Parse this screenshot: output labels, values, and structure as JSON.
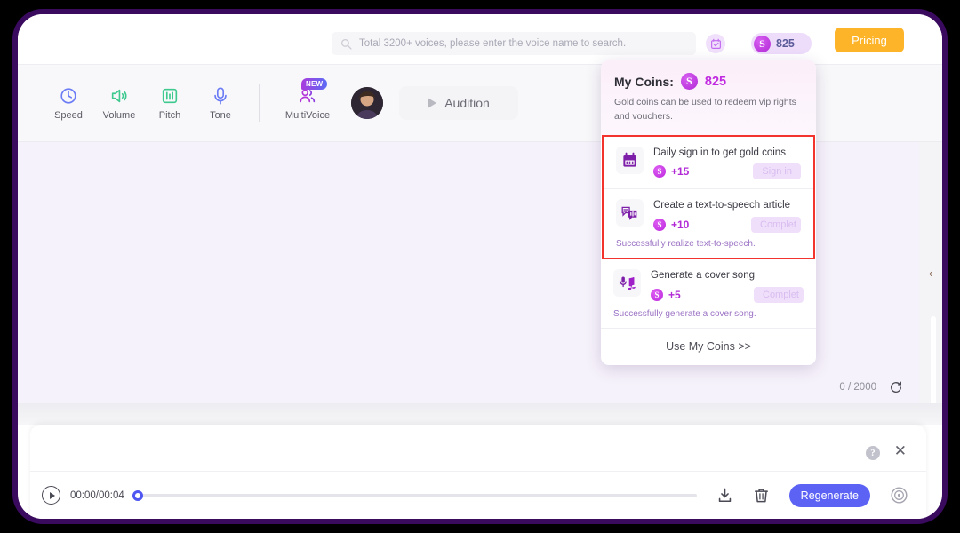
{
  "header": {
    "search": {
      "placeholder": "Total 3200+ voices, please enter the voice name to search.",
      "value": "",
      "icon": "search-icon"
    },
    "calendar_icon": "calendar-check-icon",
    "coins": {
      "amount": "825",
      "symbol": "S"
    },
    "pricing_label": "Pricing"
  },
  "toolbar": {
    "tools": [
      {
        "label": "Speed",
        "icon": "speed-gauge-icon",
        "color": "#6b7cf5"
      },
      {
        "label": "Volume",
        "icon": "volume-icon",
        "color": "#3ec98f"
      },
      {
        "label": "Pitch",
        "icon": "pitch-equalizer-icon",
        "color": "#3ec98f"
      },
      {
        "label": "Tone",
        "icon": "microphone-tone-icon",
        "color": "#6b7cf5"
      }
    ],
    "multivoice": {
      "label": "MultiVoice",
      "icon": "multivoice-people-icon",
      "badge": "NEW"
    },
    "avatar": "voice-avatar",
    "audition_label": "Audition"
  },
  "editor": {
    "text": "",
    "char_count": "0 / 2000",
    "refresh_icon": "refresh-icon"
  },
  "right_rail": {
    "chevron": "‹"
  },
  "player": {
    "help_icon": "help-icon",
    "help_glyph": "?",
    "close_icon": "close-icon",
    "close_glyph": "✕",
    "play_icon": "play-icon",
    "time": "00:00/00:04",
    "progress_percent": 0,
    "download_icon": "download-icon",
    "delete_icon": "trash-icon",
    "regenerate_label": "Regenerate",
    "effects_icon": "audio-effects-icon"
  },
  "coins_popup": {
    "title": "My Coins:",
    "amount": "825",
    "coin_symbol": "S",
    "subtitle": "Gold coins can be used to redeem vip rights and vouchers.",
    "highlight_color": "#f3342e",
    "tasks": [
      {
        "name": "Daily sign in to get gold coins",
        "icon": "calendar-icon",
        "reward": "+15",
        "button": "Sign in",
        "note": "",
        "highlighted": true
      },
      {
        "name": "Create a text-to-speech article",
        "icon": "text-to-speech-icon",
        "reward": "+10",
        "button": "Complet",
        "note": "Successfully realize text-to-speech.",
        "highlighted": true
      },
      {
        "name": "Generate a cover song",
        "icon": "cover-song-icon",
        "reward": "+5",
        "button": "Complet",
        "note": "Successfully generate a cover song.",
        "highlighted": false
      }
    ],
    "footer_label": "Use My Coins >>"
  }
}
